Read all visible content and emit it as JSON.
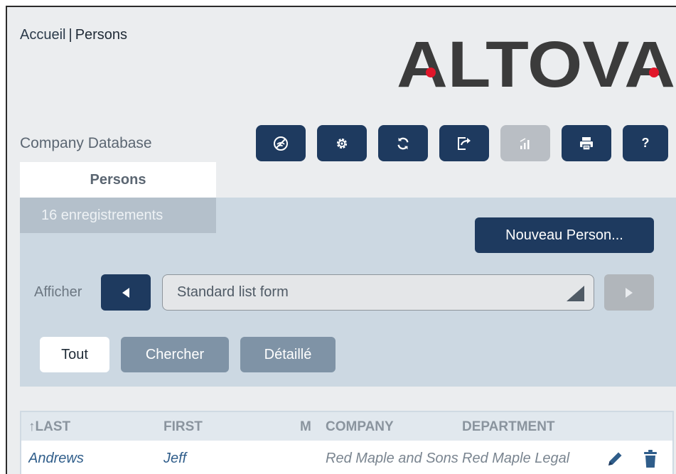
{
  "breadcrumb": {
    "home": "Accueil",
    "separator": "|",
    "current": "Persons"
  },
  "logo": {
    "text": "ALTOVA",
    "letter_color": "#3b3b3b",
    "dot_color": "#e1162a"
  },
  "app_title": "Company Database",
  "toolbar": {
    "buttons": [
      {
        "icon": "no-signal-icon",
        "enabled": true
      },
      {
        "icon": "gear-icon",
        "enabled": true
      },
      {
        "icon": "sync-icon",
        "enabled": true
      },
      {
        "icon": "export-icon",
        "enabled": true
      },
      {
        "icon": "chart-icon",
        "enabled": false
      },
      {
        "icon": "print-icon",
        "enabled": true
      },
      {
        "icon": "help-icon",
        "label": "?",
        "enabled": true
      }
    ]
  },
  "tab": {
    "label": "Persons"
  },
  "record_count": "16 enregistrements",
  "new_button": "Nouveau Person...",
  "view": {
    "label": "Afficher",
    "selected_form": "Standard list form"
  },
  "filters": {
    "all": "Tout",
    "search": "Chercher",
    "detailed": "Détaillé",
    "active": "all"
  },
  "table": {
    "columns": [
      "↑LAST",
      "FIRST",
      "M",
      "COMPANY",
      "DEPARTMENT"
    ],
    "rows": [
      {
        "last": "Andrews",
        "first": "Jeff",
        "m": "",
        "company": "Red Maple and Sons",
        "department": "Red Maple Legal"
      }
    ]
  },
  "colors": {
    "primary": "#1e3a5f",
    "disabled": "#b9bec4",
    "panel": "#ccd8e2",
    "background": "#ebedef",
    "secondary_button": "#7f93a6"
  }
}
